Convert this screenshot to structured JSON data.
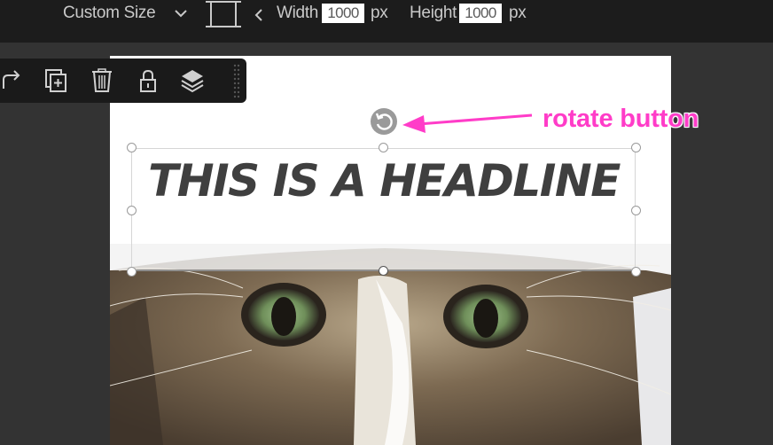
{
  "topbar": {
    "size_preset": "Custom Size",
    "width_label": "Width",
    "width_value": "1000",
    "width_unit": "px",
    "height_label": "Height",
    "height_value": "1000",
    "height_unit": "px"
  },
  "toolbar": {
    "buttons": [
      {
        "icon": "redo-icon"
      },
      {
        "icon": "duplicate-icon"
      },
      {
        "icon": "trash-icon"
      },
      {
        "icon": "lock-icon"
      },
      {
        "icon": "layers-icon"
      }
    ]
  },
  "canvas": {
    "headline": "THIS IS A HEADLINE"
  },
  "annotation": {
    "label": "rotate button",
    "color": "#ff3cc8"
  },
  "colors": {
    "workspace": "#333333",
    "topbar": "#1c1c1c",
    "toolbar": "#1a1a1a"
  }
}
